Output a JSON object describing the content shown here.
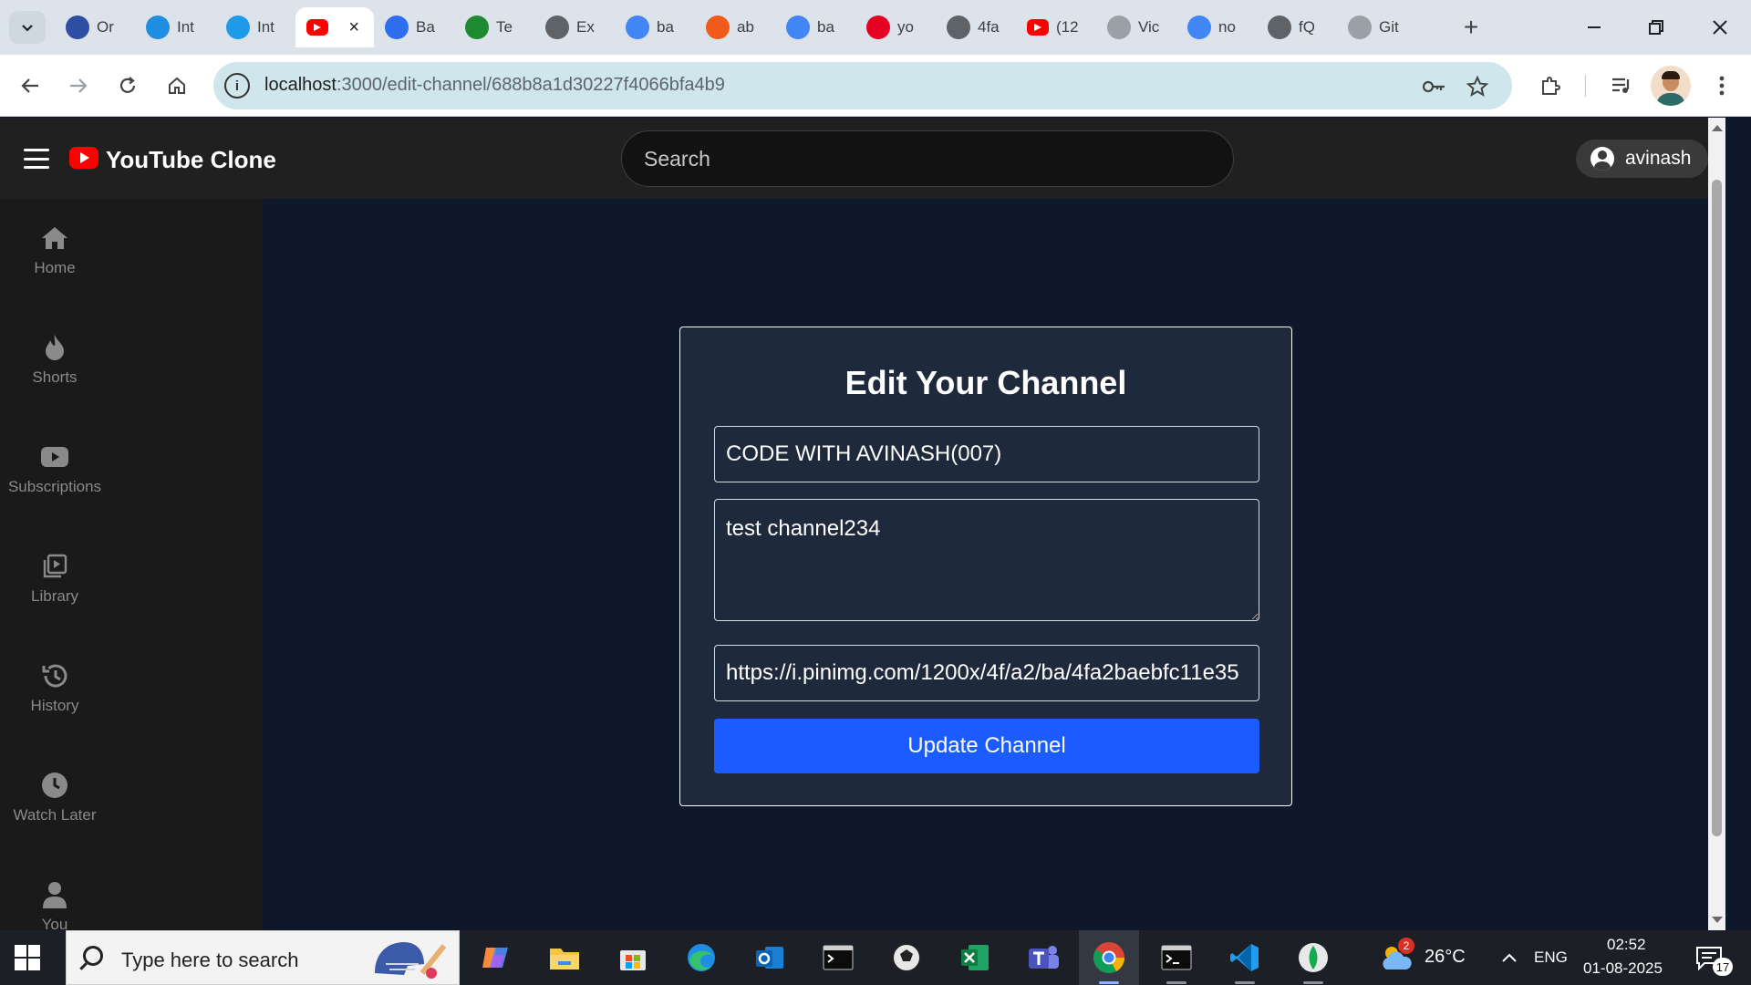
{
  "browser": {
    "tabs": [
      {
        "title": "Or",
        "icon": "opera-logo-icon",
        "color": "#2d4ea3"
      },
      {
        "title": "Int",
        "icon": "internshala-logo-icon",
        "color": "#1f8de0"
      },
      {
        "title": "Int",
        "icon": "ist-logo-icon",
        "color": "#1e9be8"
      },
      {
        "title": "",
        "icon": "youtube-logo-icon",
        "color": "#ff0000",
        "active": true
      },
      {
        "title": "Ba",
        "icon": "forms-logo-icon",
        "color": "#2f6df0"
      },
      {
        "title": "Te",
        "icon": "tc-logo-icon",
        "color": "#1d8a2f"
      },
      {
        "title": "Ex",
        "icon": "globe-icon",
        "color": "#5f6368"
      },
      {
        "title": "ba",
        "icon": "google-logo-icon",
        "color": "#4285f4"
      },
      {
        "title": "ab",
        "icon": "brave-logo-icon",
        "color": "#f05a1a"
      },
      {
        "title": "ba",
        "icon": "google-logo-icon",
        "color": "#4285f4"
      },
      {
        "title": "yo",
        "icon": "pinterest-logo-icon",
        "color": "#e60023"
      },
      {
        "title": "4fa",
        "icon": "globe-icon",
        "color": "#5f6368"
      },
      {
        "title": "(12",
        "icon": "youtube-logo-icon",
        "color": "#ff0000"
      },
      {
        "title": "Vic",
        "icon": "openai-logo-icon",
        "color": "#9aa0a6"
      },
      {
        "title": "no",
        "icon": "google-logo-icon",
        "color": "#4285f4"
      },
      {
        "title": "fQ",
        "icon": "globe-icon",
        "color": "#5f6368"
      },
      {
        "title": "Git",
        "icon": "github-logo-icon",
        "color": "#9aa0a6"
      }
    ],
    "tab_close_glyph": "×",
    "url_host": "localhost",
    "url_path": ":3000/edit-channel/688b8a1d30227f4066bfa4b9"
  },
  "app": {
    "title": "YouTube Clone",
    "search_placeholder": "Search",
    "username": "avinash",
    "brand_color": "#ff0000"
  },
  "sidebar": {
    "items": [
      {
        "label": "Home",
        "icon": "home-icon"
      },
      {
        "label": "Shorts",
        "icon": "fire-icon"
      },
      {
        "label": "Subscriptions",
        "icon": "youtube-icon"
      },
      {
        "label": "Library",
        "icon": "library-icon"
      },
      {
        "label": "History",
        "icon": "history-icon"
      },
      {
        "label": "Watch Later",
        "icon": "clock-icon"
      },
      {
        "label": "You",
        "icon": "user-icon"
      }
    ]
  },
  "form": {
    "heading": "Edit Your Channel",
    "channel_name": "CODE WITH AVINASH(007)",
    "description": "test channel234",
    "banner_url": "https://i.pinimg.com/1200x/4f/a2/ba/4fa2baebfc11e35",
    "submit_label": "Update Channel",
    "button_color": "#1a5cff"
  },
  "taskbar": {
    "search_placeholder": "Type here to search",
    "weather_badge": "2",
    "temperature": "26°C",
    "language": "ENG",
    "time": "02:52",
    "date": "01-08-2025",
    "notification_count": "17"
  }
}
